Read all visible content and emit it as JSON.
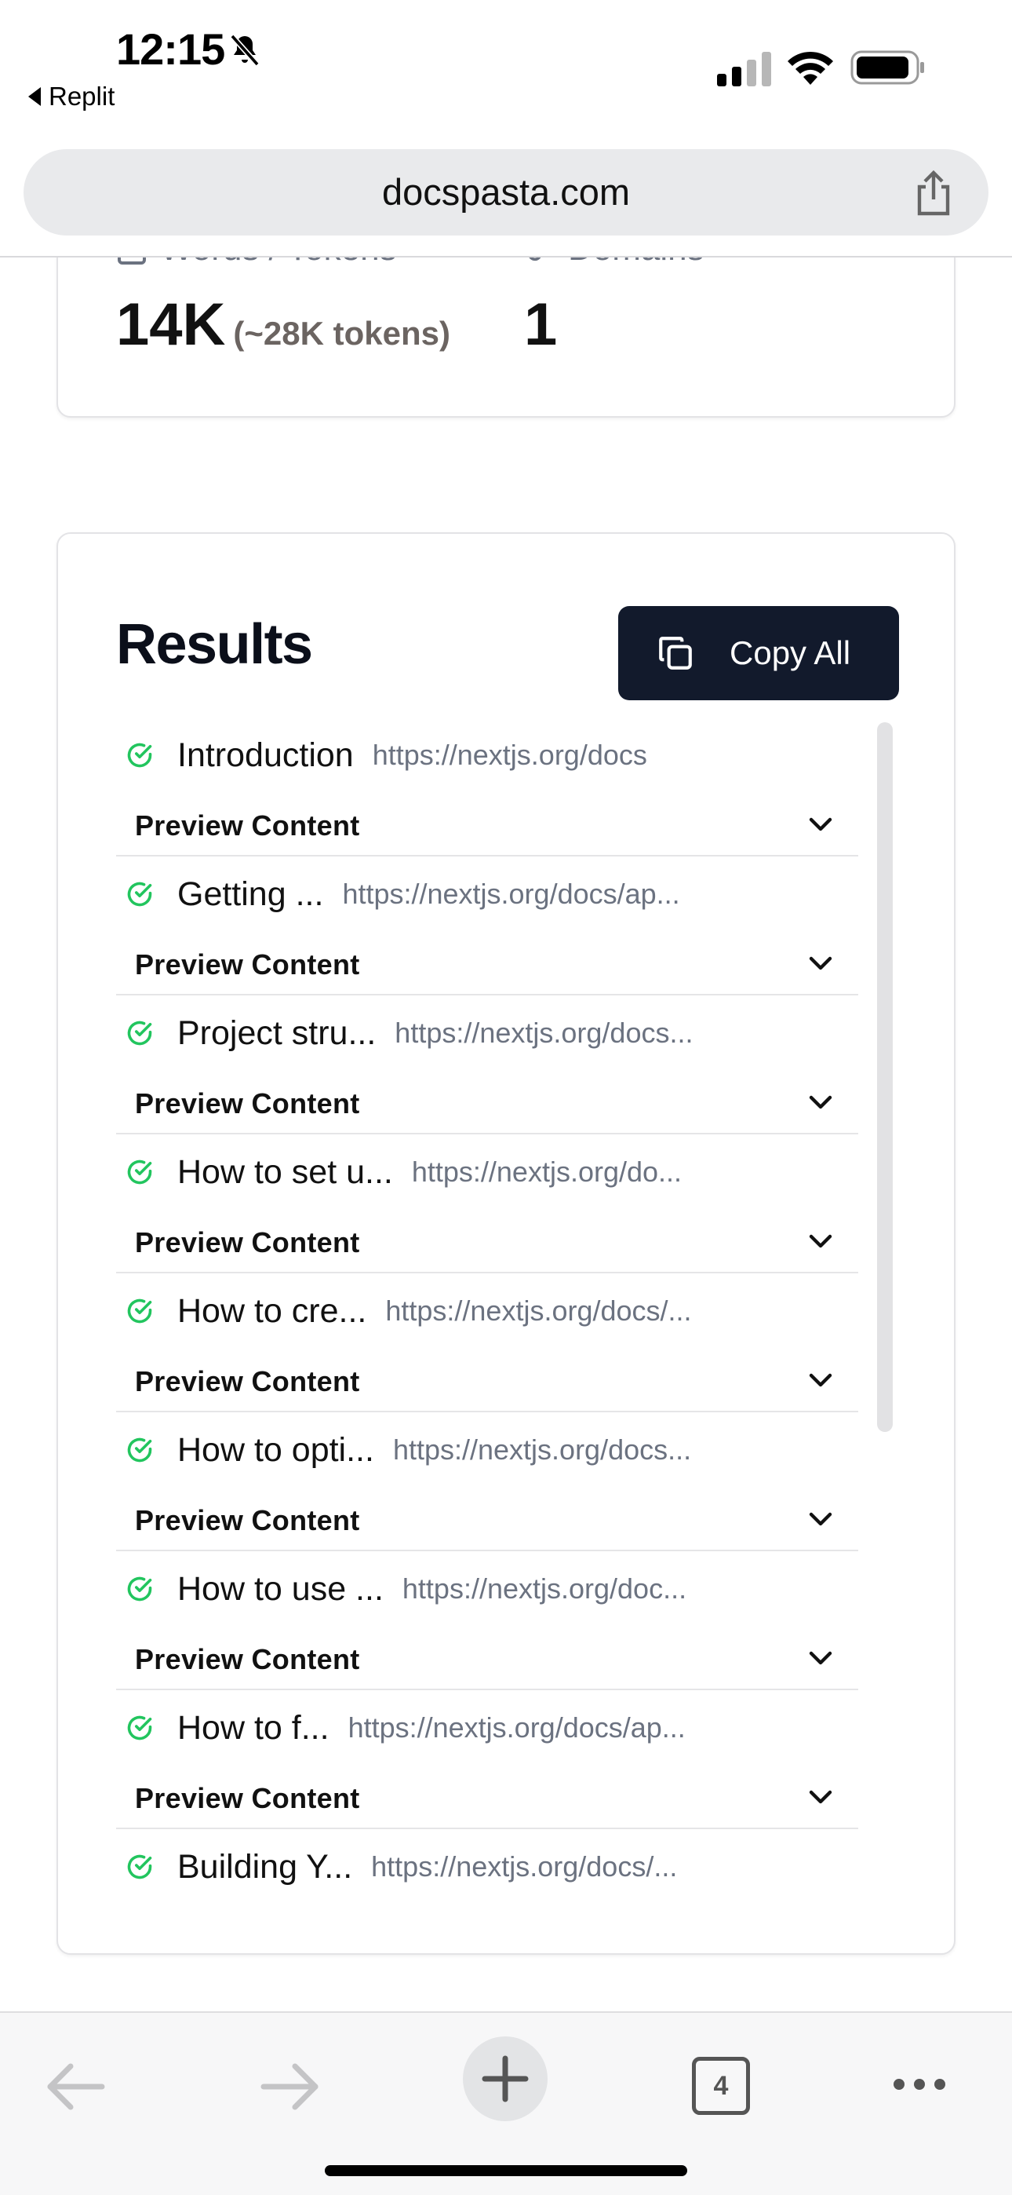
{
  "status_bar": {
    "time": "12:15",
    "back_app": "Replit"
  },
  "browser": {
    "url": "docspasta.com"
  },
  "stats": {
    "words_label": "Words / Tokens",
    "words_value": "14K",
    "tokens_value": "(~28K tokens)",
    "domains_label": "Domains",
    "domains_value": "1"
  },
  "results": {
    "title": "Results",
    "copy_all_label": "Copy All",
    "preview_label": "Preview Content",
    "items": [
      {
        "title": "Introduction",
        "url": "https://nextjs.org/docs"
      },
      {
        "title": "Getting ...",
        "url": "https://nextjs.org/docs/ap..."
      },
      {
        "title": "Project stru...",
        "url": "https://nextjs.org/docs..."
      },
      {
        "title": "How to set u...",
        "url": "https://nextjs.org/do..."
      },
      {
        "title": "How to cre...",
        "url": "https://nextjs.org/docs/..."
      },
      {
        "title": "How to opti...",
        "url": "https://nextjs.org/docs..."
      },
      {
        "title": "How to use ...",
        "url": "https://nextjs.org/doc..."
      },
      {
        "title": "How to f...",
        "url": "https://nextjs.org/docs/ap..."
      },
      {
        "title": "Building Y...",
        "url": "https://nextjs.org/docs/..."
      }
    ]
  },
  "toolbar": {
    "tab_count": "4"
  },
  "colors": {
    "accent_button": "#121a2c",
    "check_green": "#22c55e",
    "url_gray": "#6b7280"
  }
}
